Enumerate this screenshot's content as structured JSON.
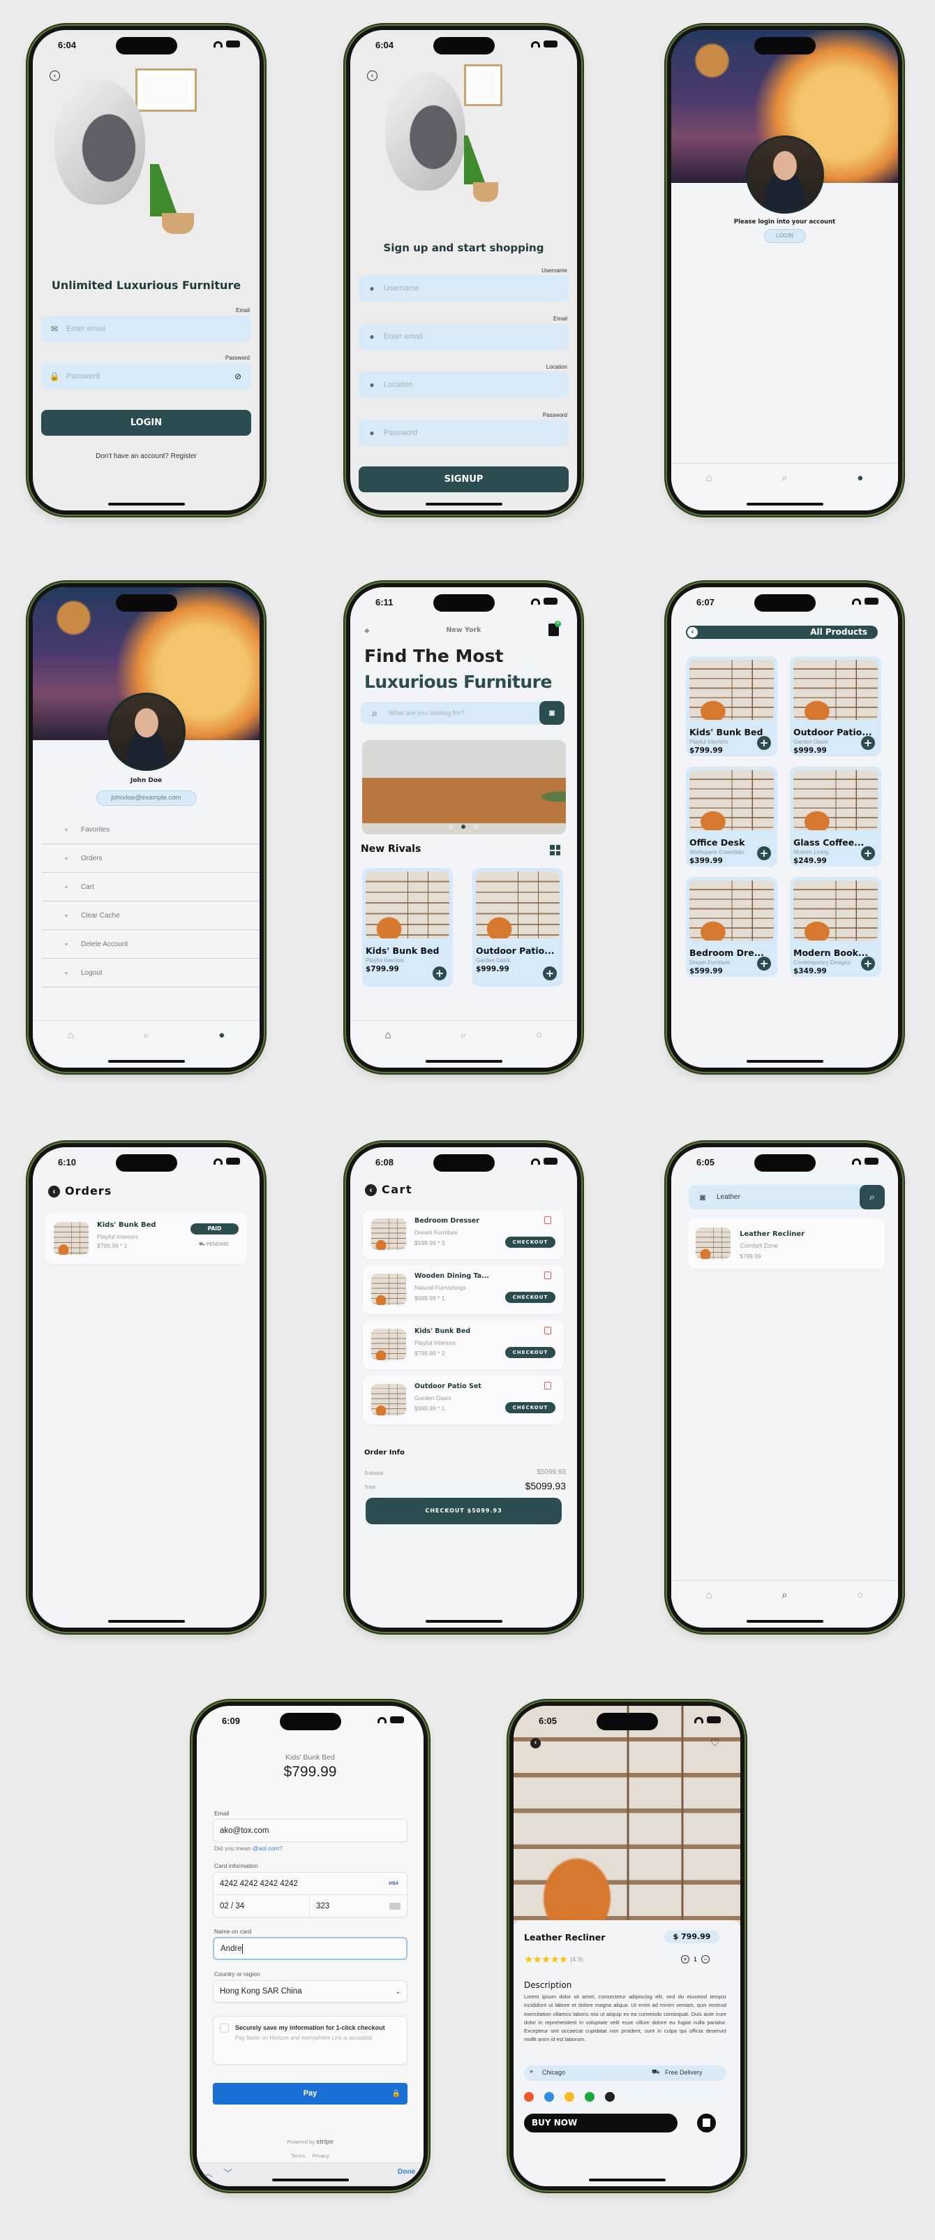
{
  "colors": {
    "accent": "#2c4d50",
    "field_bg": "#d8eaf8",
    "card_bg": "#d6e9f8",
    "stripe_pay": "#1a6fd4",
    "trash": "#e05a5a",
    "star": "#f5c518",
    "frame_green": "#58793a"
  },
  "nav": {
    "items": [
      {
        "icon": "home-icon"
      },
      {
        "icon": "search-icon"
      },
      {
        "icon": "person-icon"
      }
    ]
  },
  "login": {
    "time": "6:04",
    "title": "Unlimited Luxurious Furniture",
    "email_label": "Email",
    "email_placeholder": "Enter email",
    "password_label": "Password",
    "password_placeholder": "Password",
    "button": "LOGIN",
    "register_text": "Don't have an account? Register"
  },
  "signup": {
    "time": "6:04",
    "title": "Sign up and start shopping",
    "fields": [
      {
        "label": "Username",
        "placeholder": "Username",
        "icon": "user-face-icon"
      },
      {
        "label": "Email",
        "placeholder": "Enter email",
        "icon": "mail-icon"
      },
      {
        "label": "Location",
        "placeholder": "Location",
        "icon": "location-pin-icon"
      },
      {
        "label": "Password",
        "placeholder": "Password",
        "icon": "lock-icon"
      }
    ],
    "button": "SIGNUP"
  },
  "guest": {
    "message": "Please login into your account",
    "login_button": "LOGIN"
  },
  "profile": {
    "name": "John Doe",
    "email": "johndoe@example.com",
    "menu": [
      {
        "label": "Favorites",
        "icon": "heart-icon"
      },
      {
        "label": "Orders",
        "icon": "truck-icon"
      },
      {
        "label": "Cart",
        "icon": "bag-icon"
      },
      {
        "label": "Clear Cache",
        "icon": "refresh-icon"
      },
      {
        "label": "Delete Account",
        "icon": "user-x-icon"
      },
      {
        "label": "Logout",
        "icon": "logout-icon"
      }
    ]
  },
  "home": {
    "time": "6:11",
    "location": "New York",
    "cart_badge": "4",
    "title_line1": "Find The Most",
    "title_line2": "Luxurious Furniture",
    "search_placeholder": "What are you looking for?",
    "carousel_active": 2,
    "carousel_count": 3,
    "section_title": "New Rivals",
    "products": [
      {
        "name": "Kids' Bunk Bed",
        "brand": "Playful Interiors",
        "price": "$799.99"
      },
      {
        "name": "Outdoor Patio...",
        "brand": "Garden Oasis",
        "price": "$999.99"
      }
    ]
  },
  "all_products": {
    "time": "6:07",
    "title": "All Products",
    "products": [
      {
        "name": "Kids' Bunk Bed",
        "brand": "Playful Interiors",
        "price": "$799.99"
      },
      {
        "name": "Outdoor Patio...",
        "brand": "Garden Oasis",
        "price": "$999.99"
      },
      {
        "name": "Office Desk",
        "brand": "Workspace Essentials",
        "price": "$399.99"
      },
      {
        "name": "Glass Coffee...",
        "brand": "Modern Living",
        "price": "$249.99"
      },
      {
        "name": "Bedroom Dre...",
        "brand": "Dream Furniture",
        "price": "$599.99"
      },
      {
        "name": "Modern Book...",
        "brand": "Contemporary Designs",
        "price": "$349.99"
      }
    ]
  },
  "orders": {
    "time": "6:10",
    "title": "Orders",
    "items": [
      {
        "name": "Kids' Bunk Bed",
        "brand": "Playful Interiors",
        "price_qty": "$799.99 * 1",
        "payment": "PAID",
        "delivery": "PENDING"
      }
    ]
  },
  "cart": {
    "time": "6:08",
    "title": "Cart",
    "checkout_label": "CHECKOUT",
    "items": [
      {
        "name": "Bedroom Dresser",
        "brand": "Dream Furniture",
        "price_qty": "$599.99 * 3"
      },
      {
        "name": "Wooden Dining Ta...",
        "brand": "Natural Furnishings",
        "price_qty": "$699.99 * 1"
      },
      {
        "name": "Kids' Bunk Bed",
        "brand": "Playful Interiors",
        "price_qty": "$799.99 * 2"
      },
      {
        "name": "Outdoor Patio Set",
        "brand": "Garden Oasis",
        "price_qty": "$999.99 * 1"
      }
    ],
    "order_info": "Order Info",
    "subtotal_label": "Subtotal",
    "subtotal": "$5099.93",
    "total_label": "Total",
    "total": "$5099.93",
    "checkout_total": "CHECKOUT $5099.93"
  },
  "search": {
    "time": "6:05",
    "query": "Leather",
    "results": [
      {
        "name": "Leather Recliner",
        "brand": "Comfort Zone",
        "price": "$799.99"
      }
    ]
  },
  "payment": {
    "time": "6:09",
    "product": "Kids' Bunk Bed",
    "price": "$799.99",
    "email_label": "Email",
    "email_value": "ako@tox.com",
    "suggestion_prefix": "Did you mean ",
    "suggestion_link": "@aol.com",
    "suggestion_suffix": "?",
    "card_label": "Card information",
    "card_number": "4242 4242 4242 4242",
    "card_brand": "VISA",
    "expiry": "02 / 34",
    "cvc": "323",
    "name_label": "Name on card",
    "name_value": "Andre",
    "country_label": "Country or region",
    "country_value": "Hong Kong SAR China",
    "save_title": "Securely save my information for 1-click checkout",
    "save_desc": "Pay faster on Horizon and everywhere Link is accepted.",
    "pay_button": "Pay",
    "powered_by": "Powered by",
    "stripe": "stripe",
    "terms": "Terms",
    "privacy": "Privacy",
    "done": "Done"
  },
  "detail": {
    "time": "6:05",
    "name": "Leather Recliner",
    "price": "$ 799.99",
    "rating_value": 4.9,
    "rating": "(4.9)",
    "quantity": "1",
    "description_title": "Description",
    "description": "Lorem ipsum dolor sit amet, consectetur adipiscing elit, sed do eiusmod tempor incididunt ut labore et dolore magna aliqua. Ut enim ad minim veniam, quis nostrud exercitation ullamco laboris nisi ut aliquip ex ea commodo consequat. Duis aute irure dolor in reprehenderit in voluptate velit esse cillum dolore eu fugiat nulla pariatur. Excepteur sint occaecat cupidatat non proident, sunt in culpa qui officia deserunt mollit anim id est laborum.",
    "location": "Chicago",
    "delivery": "Free Delivery",
    "colors": [
      "#f05a28",
      "#2f8de4",
      "#fbb91e",
      "#1aaa3c",
      "#222222"
    ],
    "buy_now": "BUY NOW"
  }
}
